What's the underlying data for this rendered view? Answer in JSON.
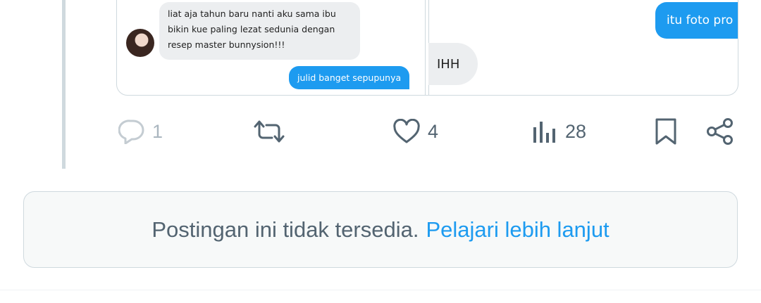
{
  "media": {
    "left_panel": {
      "incoming_message": "liat aja tahun baru nanti aku sama ibu bikin kue paling lezat sedunia dengan resep master bunnysion!!!",
      "outgoing_message": "julid banget sepupunya"
    },
    "right_panel": {
      "outgoing_message": "itu foto pro",
      "incoming_message": "IHH"
    }
  },
  "actions": {
    "reply_count": "1",
    "like_count": "4",
    "view_count": "28"
  },
  "notice": {
    "text": "Postingan ini tidak tersedia.",
    "link": "Pelajari lebih lanjut"
  },
  "colors": {
    "accent": "#1d9bf0",
    "muted": "#536471",
    "border": "#cfd9de"
  }
}
